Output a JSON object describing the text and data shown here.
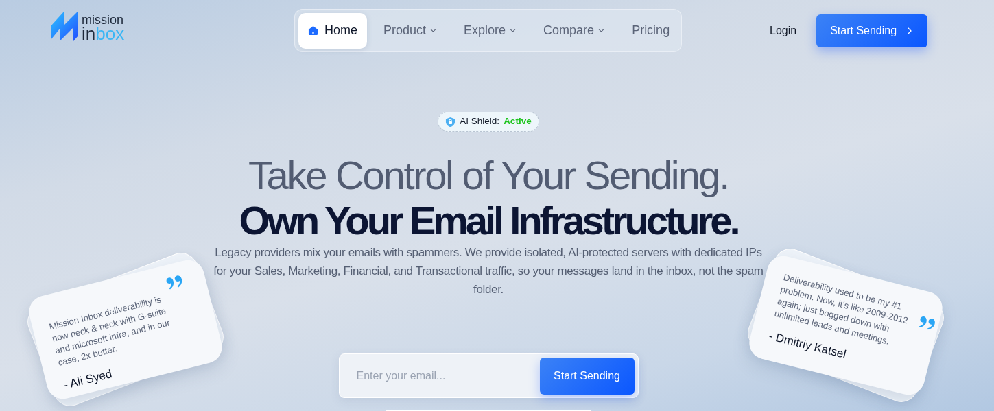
{
  "logo": {
    "top": "mission",
    "bottom": [
      {
        "text": "in",
        "kind": "plain"
      },
      {
        "text": "box",
        "kind": "accent"
      }
    ]
  },
  "nav": {
    "items": [
      {
        "label": "Home",
        "kind": "icon",
        "selected": true
      },
      {
        "label": "Product",
        "kind": "dropdown",
        "selected": false
      },
      {
        "label": "Explore",
        "kind": "dropdown",
        "selected": false
      },
      {
        "label": "Compare",
        "kind": "dropdown",
        "selected": false
      },
      {
        "label": "Pricing",
        "kind": "link",
        "selected": false
      }
    ]
  },
  "header_actions": {
    "login": "Login",
    "cta": "Start Sending"
  },
  "hero": {
    "badge": {
      "label": "AI Shield:",
      "status": "Active"
    },
    "headline": [
      {
        "text": "Take Control of Your Sending.",
        "kind": "muted"
      },
      {
        "text": "Own Your Email Infrastructure.",
        "kind": "strong"
      }
    ],
    "description": "Legacy providers mix your emails with spammers. We provide isolated, AI-protected servers with dedicated IPs for your Sales, Marketing, Financial, and Transactional traffic, so your messages land in the inbox, not the spam folder.",
    "email_form": {
      "placeholder": "Enter your email...",
      "button": "Start Sending"
    }
  },
  "testimonials": [
    {
      "quote": "Mission Inbox deliverability is now neck & neck with G-suite and microsoft infra, and in our case, 2x better.",
      "author": "- Ali Syed"
    },
    {
      "quote": "Deliverability used to be my #1 problem. Now, it's like 2009-2012 again; just bogged down with unlimited leads and meetings.",
      "author": "- Dmitriy Katsel"
    }
  ]
}
